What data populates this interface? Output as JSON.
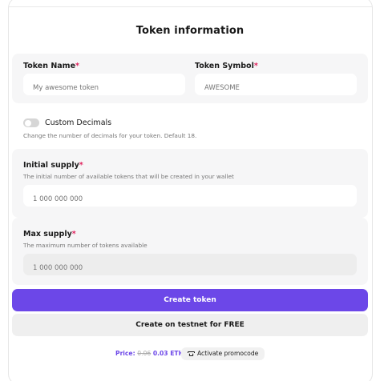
{
  "form": {
    "title": "Token information",
    "required_mark": "*",
    "token_name": {
      "label": "Token Name",
      "placeholder": "My awesome token"
    },
    "token_symbol": {
      "label": "Token Symbol",
      "placeholder": "AWESOME"
    },
    "custom_decimals": {
      "label": "Custom Decimals",
      "hint": "Change the number of decimals for your token. Default 18.",
      "enabled": false
    },
    "initial_supply": {
      "label": "Initial supply",
      "hint": "The initial number of available tokens that will be created in your wallet",
      "placeholder": "1 000 000 000"
    },
    "max_supply": {
      "label": "Max supply",
      "hint": "The maximum number of tokens available",
      "placeholder": "1 000 000 000",
      "disabled": true
    }
  },
  "actions": {
    "create_label": "Create token",
    "testnet_label": "Create on testnet for FREE"
  },
  "price": {
    "label": "Price:",
    "old_value": "0.06",
    "new_value": "0.03 ETH"
  },
  "promo": {
    "label": "Activate promocode",
    "icon": "ticket-icon"
  },
  "colors": {
    "accent": "#6c47e8",
    "required": "#e0245e"
  }
}
